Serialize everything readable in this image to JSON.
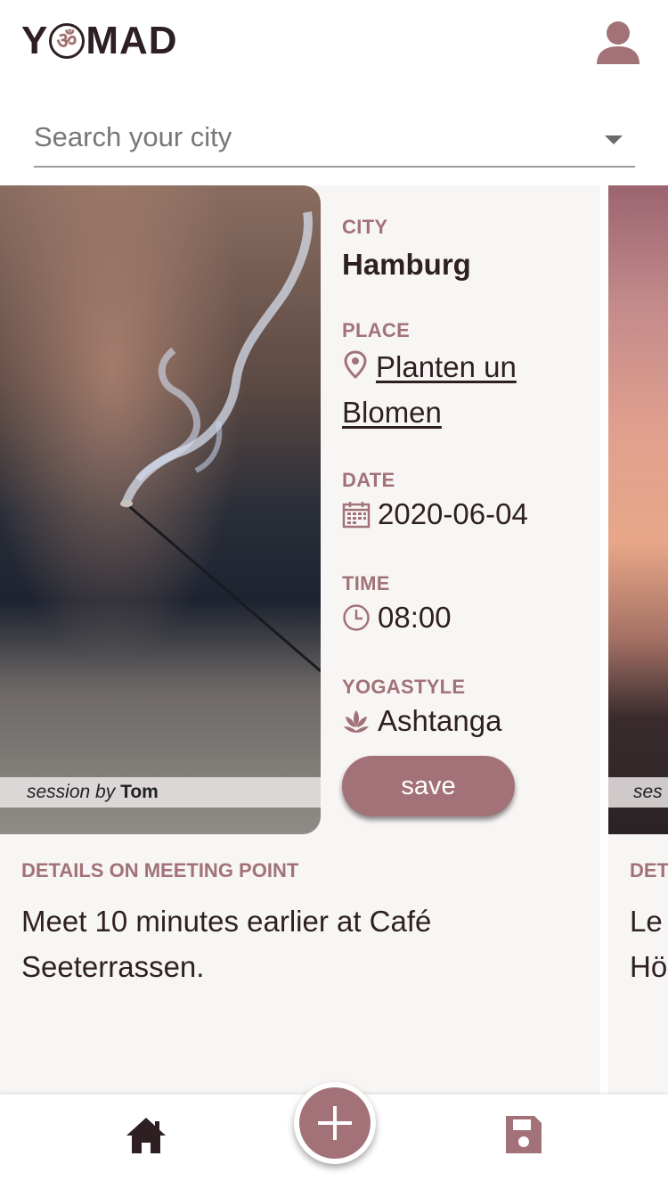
{
  "header": {
    "logo_left": "Y",
    "logo_symbol": "ॐ",
    "logo_right": "MAD",
    "profile_icon": "user-icon"
  },
  "search": {
    "placeholder": "Search your city",
    "value": ""
  },
  "session": {
    "credit_prefix": "session by",
    "credit_name": "Tom",
    "city_label": "CITY",
    "city": "Hamburg",
    "place_label": "PLACE",
    "place": "Planten un Blomen",
    "date_label": "DATE",
    "date": "2020-06-04",
    "time_label": "TIME",
    "time": "08:00",
    "style_label": "YOGASTYLE",
    "style": "Ashtanga",
    "save_label": "save",
    "details_label": "DETAILS ON MEETING POINT",
    "details": "Meet 10 minutes earlier at Café Seeterrassen."
  },
  "next_session": {
    "credit": "ses",
    "details_label": "DET",
    "details_line1": "Le",
    "details_line2": "Hö"
  },
  "nav": {
    "home_icon": "home-icon",
    "add_icon": "plus-icon",
    "saved_icon": "floppy-disk-icon"
  },
  "colors": {
    "accent": "#a27278",
    "text": "#2e1f22",
    "card_bg": "#f8f6f5"
  }
}
